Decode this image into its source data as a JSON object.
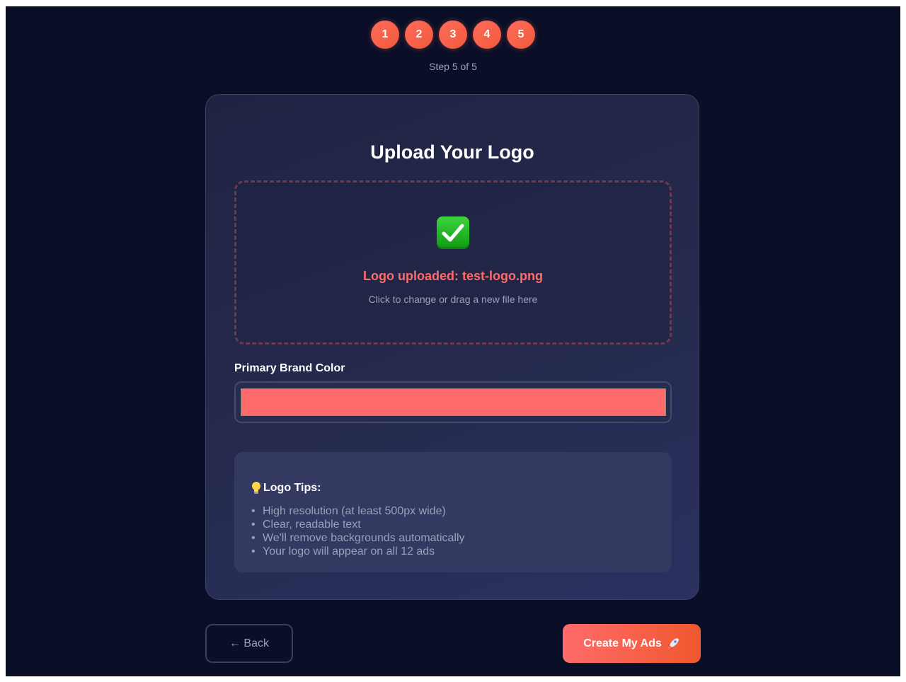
{
  "progress": {
    "steps": [
      "1",
      "2",
      "3",
      "4",
      "5"
    ],
    "status_text": "Step 5 of 5",
    "current_step": 5,
    "total_steps": 5
  },
  "card": {
    "title": "Upload Your Logo",
    "upload": {
      "icon": "check-mark-button-icon",
      "status": "Logo uploaded: test-logo.png",
      "hint": "Click to change or drag a new file here"
    },
    "brand_color": {
      "label": "Primary Brand Color",
      "value": "#ff6b6b"
    },
    "tips": {
      "icon": "light-bulb-icon",
      "title": "Logo Tips:",
      "items": [
        "High resolution (at least 500px wide)",
        "Clear, readable text",
        "We'll remove backgrounds automatically",
        "Your logo will appear on all 12 ads"
      ]
    }
  },
  "footer": {
    "back_label": "← Back",
    "create_label": "Create My Ads",
    "create_icon": "rocket-icon"
  },
  "colors": {
    "background": "#0a0e27",
    "accent": "#ff6b6b",
    "success": "#1fb81f"
  }
}
